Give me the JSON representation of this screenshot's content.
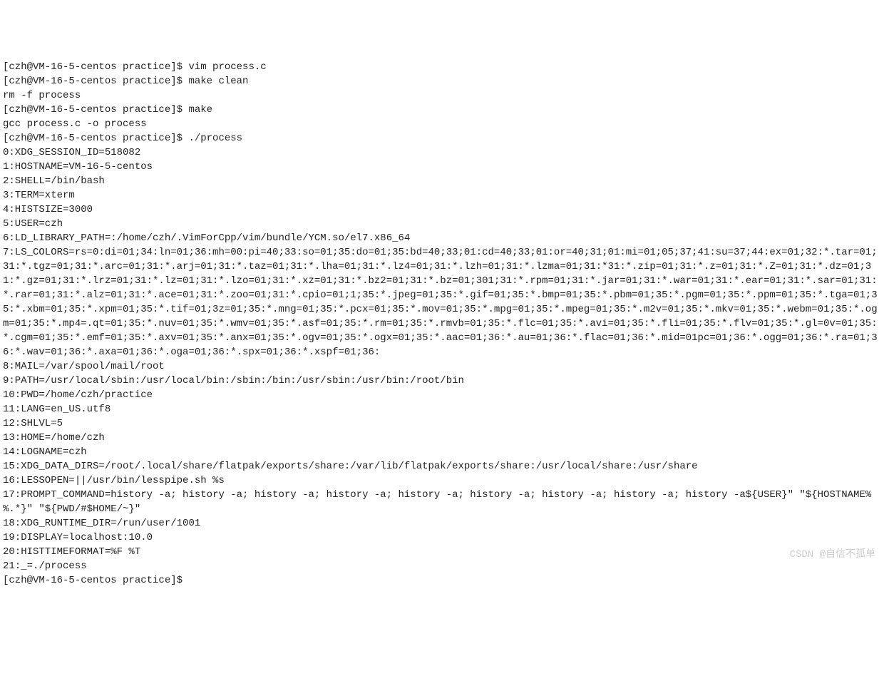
{
  "prompt": "[czh@VM-16-5-centos practice]$ ",
  "commands": {
    "vim": "vim process.c",
    "make_clean": "make clean",
    "make_clean_output": "rm -f process",
    "make": "make",
    "make_output": "gcc process.c -o process",
    "run": "./process"
  },
  "env_lines": [
    "0:XDG_SESSION_ID=518082",
    "1:HOSTNAME=VM-16-5-centos",
    "2:SHELL=/bin/bash",
    "3:TERM=xterm",
    "4:HISTSIZE=3000",
    "5:USER=czh",
    "6:LD_LIBRARY_PATH=:/home/czh/.VimForCpp/vim/bundle/YCM.so/el7.x86_64",
    "7:LS_COLORS=rs=0:di=01;34:ln=01;36:mh=00:pi=40;33:so=01;35:do=01;35:bd=40;33;01:cd=40;33;01:or=40;31;01:mi=01;05;37;41:su=37;44:ex=01;32:*.tar=01;31:*.tgz=01;31:*.arc=01;31:*.arj=01;31:*.taz=01;31:*.lha=01;31:*.lz4=01;31:*.lzh=01;31:*.lzma=01;31:*31:*.zip=01;31:*.z=01;31:*.Z=01;31:*.dz=01;31:*.gz=01;31:*.lrz=01;31:*.lz=01;31:*.lzo=01;31:*.xz=01;31:*.bz2=01;31:*.bz=01;301;31:*.rpm=01;31:*.jar=01;31:*.war=01;31:*.ear=01;31:*.sar=01;31:*.rar=01;31:*.alz=01;31:*.ace=01;31:*.zoo=01;31:*.cpio=01;1;35:*.jpeg=01;35:*.gif=01;35:*.bmp=01;35:*.pbm=01;35:*.pgm=01;35:*.ppm=01;35:*.tga=01;35:*.xbm=01;35:*.xpm=01;35:*.tif=01;3z=01;35:*.mng=01;35:*.pcx=01;35:*.mov=01;35:*.mpg=01;35:*.mpeg=01;35:*.m2v=01;35:*.mkv=01;35:*.webm=01;35:*.ogm=01;35:*.mp4=.qt=01;35:*.nuv=01;35:*.wmv=01;35:*.asf=01;35:*.rm=01;35:*.rmvb=01;35:*.flc=01;35:*.avi=01;35:*.fli=01;35:*.flv=01;35:*.gl=0v=01;35:*.cgm=01;35:*.emf=01;35:*.axv=01;35:*.anx=01;35:*.ogv=01;35:*.ogx=01;35:*.aac=01;36:*.au=01;36:*.flac=01;36:*.mid=01pc=01;36:*.ogg=01;36:*.ra=01;36:*.wav=01;36:*.axa=01;36:*.oga=01;36:*.spx=01;36:*.xspf=01;36:",
    "8:MAIL=/var/spool/mail/root",
    "9:PATH=/usr/local/sbin:/usr/local/bin:/sbin:/bin:/usr/sbin:/usr/bin:/root/bin",
    "10:PWD=/home/czh/practice",
    "11:LANG=en_US.utf8",
    "12:SHLVL=5",
    "13:HOME=/home/czh",
    "14:LOGNAME=czh",
    "15:XDG_DATA_DIRS=/root/.local/share/flatpak/exports/share:/var/lib/flatpak/exports/share:/usr/local/share:/usr/share",
    "16:LESSOPEN=||/usr/bin/lesspipe.sh %s",
    "17:PROMPT_COMMAND=history -a; history -a; history -a; history -a; history -a; history -a; history -a; history -a; history -a${USER}\" \"${HOSTNAME%%.*}\" \"${PWD/#$HOME/~}\"",
    "18:XDG_RUNTIME_DIR=/run/user/1001",
    "19:DISPLAY=localhost:10.0",
    "20:HISTTIMEFORMAT=%F %T",
    "21:_=./process"
  ],
  "watermark": "CSDN @自信不孤单"
}
